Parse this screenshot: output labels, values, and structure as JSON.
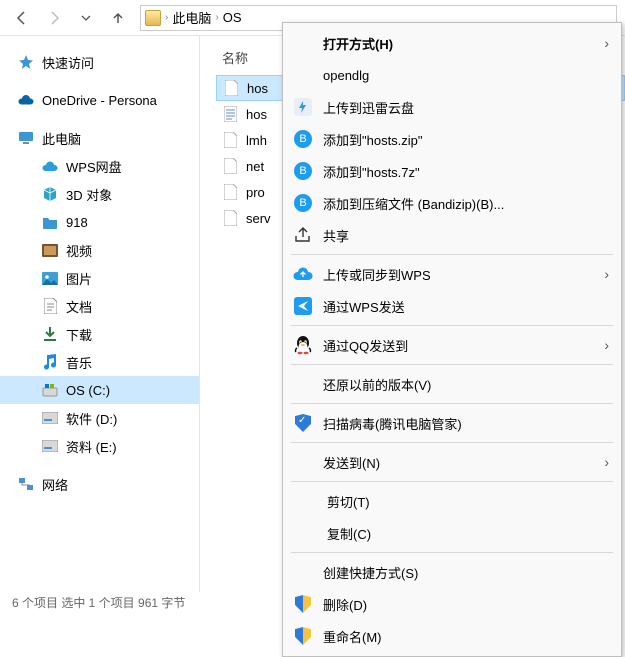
{
  "toolbar": {
    "crumb1": "此电脑",
    "crumb2": "OS"
  },
  "sidebar": {
    "quick": "快速访问",
    "onedrive": "OneDrive - Persona",
    "thispc": "此电脑",
    "items": [
      {
        "label": "WPS网盘"
      },
      {
        "label": "3D 对象"
      },
      {
        "label": "918"
      },
      {
        "label": "视频"
      },
      {
        "label": "图片"
      },
      {
        "label": "文档"
      },
      {
        "label": "下载"
      },
      {
        "label": "音乐"
      },
      {
        "label": "OS (C:)"
      },
      {
        "label": "软件 (D:)"
      },
      {
        "label": "资料 (E:)"
      }
    ],
    "network": "网络"
  },
  "content": {
    "col": "名称",
    "files": [
      {
        "name": "hos"
      },
      {
        "name": "hos"
      },
      {
        "name": "lmh"
      },
      {
        "name": "net"
      },
      {
        "name": "pro"
      },
      {
        "name": "serv"
      }
    ]
  },
  "status": "6 个项目    选中 1 个项目  961 字节",
  "ctx": {
    "open": "打开方式(H)",
    "opendlg": "opendlg",
    "xunlei": "上传到迅雷云盘",
    "ziphosts": "添加到\"hosts.zip\"",
    "7zhosts": "添加到\"hosts.7z\"",
    "bandizip": "添加到压缩文件 (Bandizip)(B)...",
    "share": "共享",
    "wpsup": "上传或同步到WPS",
    "wpssend": "通过WPS发送",
    "qq": "通过QQ发送到",
    "restore": "还原以前的版本(V)",
    "scan": "扫描病毒(腾讯电脑管家)",
    "sendto": "发送到(N)",
    "cut": "剪切(T)",
    "copy": "复制(C)",
    "shortcut": "创建快捷方式(S)",
    "delete": "删除(D)",
    "rename": "重命名(M)"
  }
}
